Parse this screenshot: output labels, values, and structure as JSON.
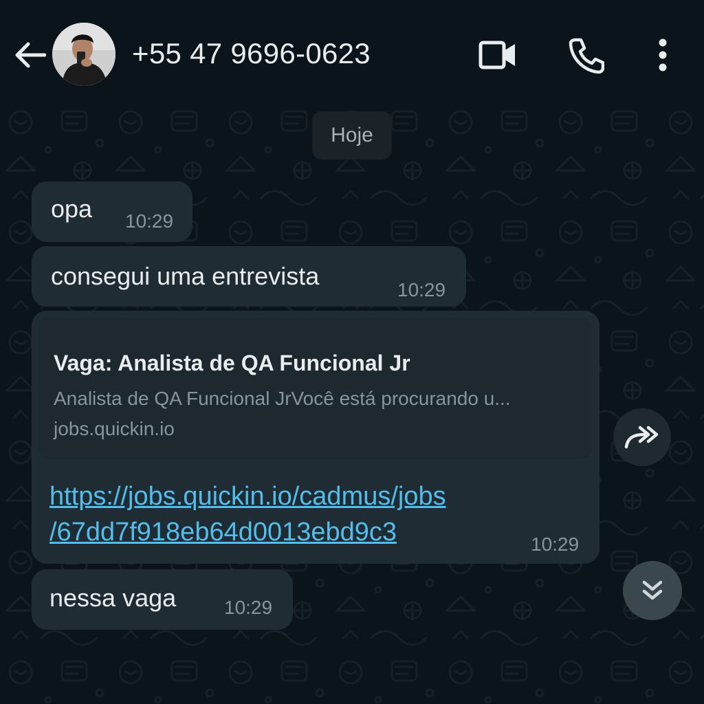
{
  "header": {
    "back_icon": "arrow-left-icon",
    "contact_name": "+55 47 9696-0623",
    "icons": {
      "video": "video-camera-icon",
      "call": "phone-icon",
      "menu": "more-vertical-icon"
    }
  },
  "chat": {
    "date_chip": "Hoje",
    "messages": [
      {
        "text": "opa",
        "time": "10:29"
      },
      {
        "text": "consegui uma entrevista",
        "time": "10:29"
      },
      {
        "preview_title": "Vaga: Analista de QA Funcional Jr",
        "preview_description": "Analista de QA Funcional JrVocê está procurando u...",
        "preview_domain": "jobs.quickin.io",
        "link_line1": "https://jobs.quickin.io/cadmus/jobs",
        "link_line2": "/67dd7f918eb64d0013ebd9c3",
        "time": "10:29"
      },
      {
        "text": "nessa vaga",
        "time": "10:29"
      }
    ],
    "forward_icon": "forward-icon",
    "scroll_down_icon": "double-chevron-down-icon"
  },
  "colors": {
    "background": "#0b141a",
    "bubble": "#202c33",
    "link": "#53bdeb",
    "secondary_text": "#8696a0"
  }
}
